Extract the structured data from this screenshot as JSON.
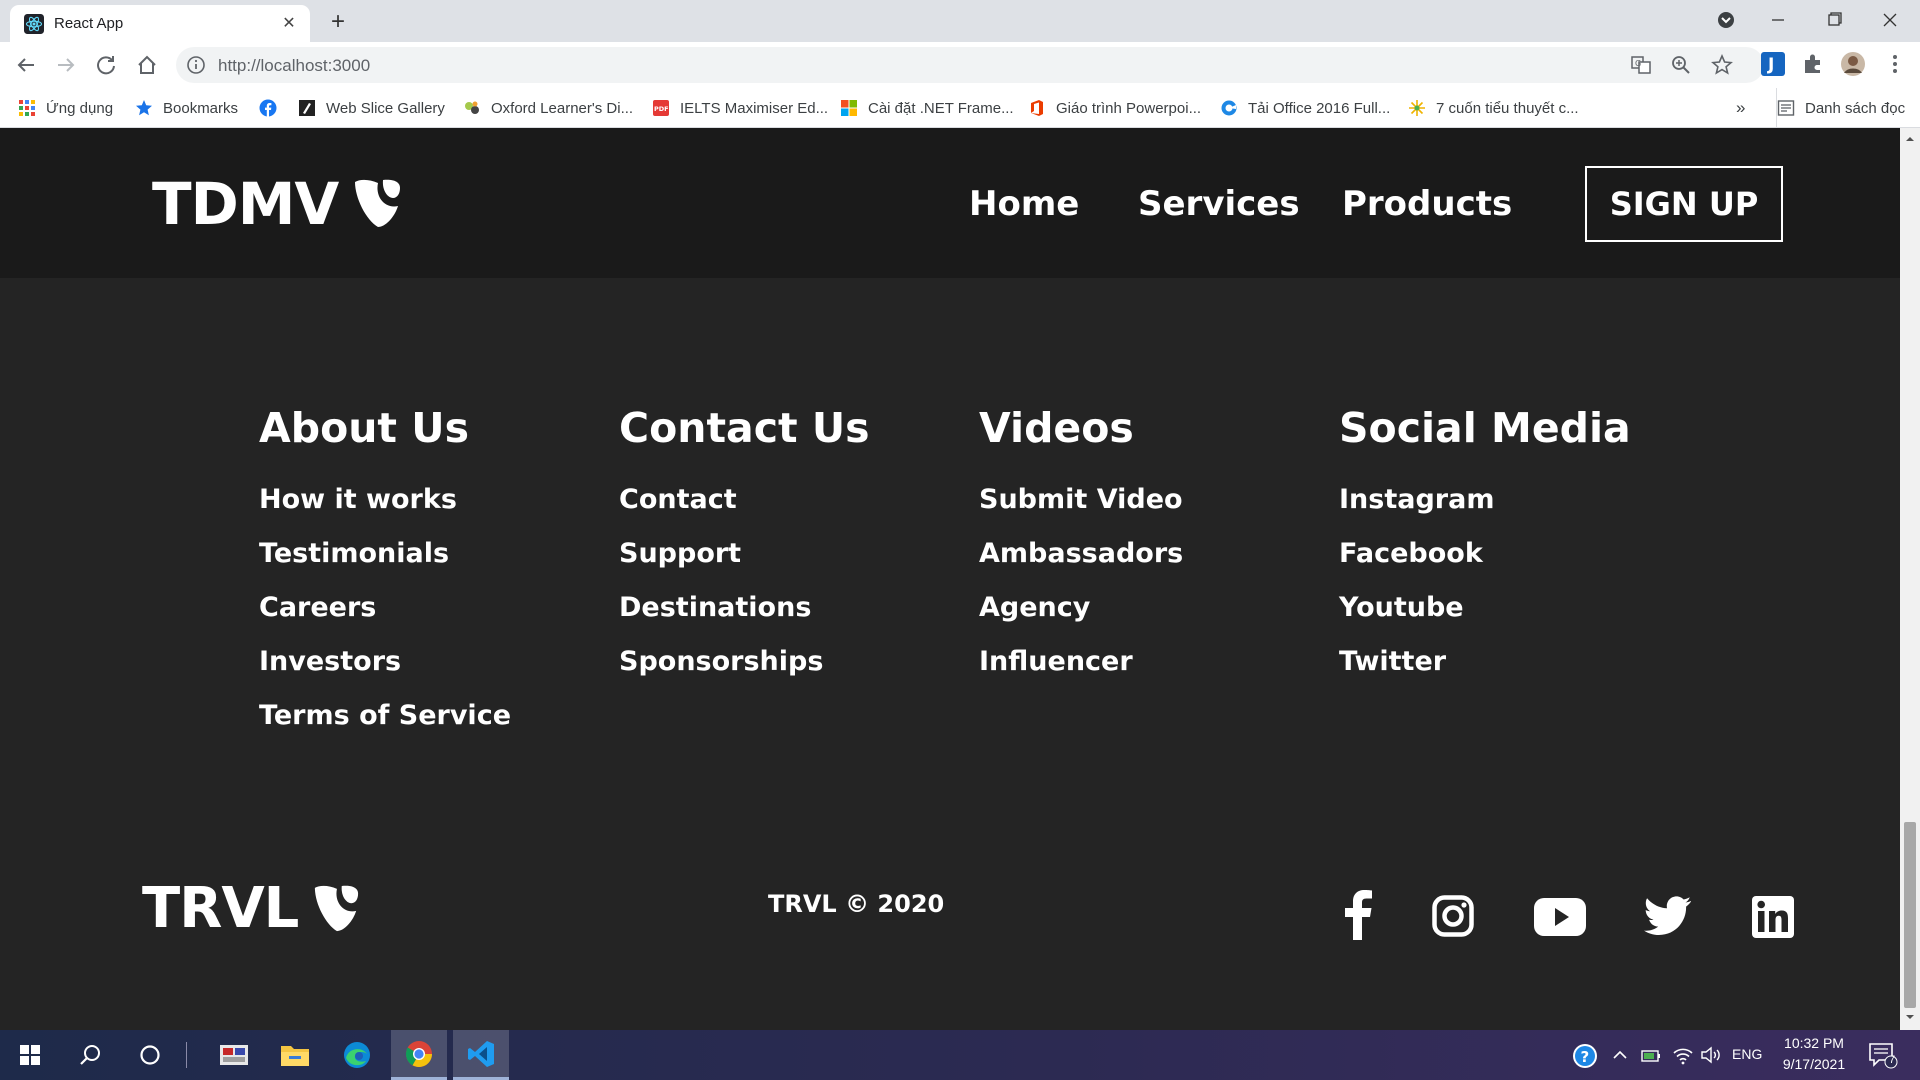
{
  "browser": {
    "tab_title": "React App",
    "url": "http://localhost:3000",
    "bookmarks": [
      {
        "label": "Ứng dụng",
        "icon": "apps-grid-icon"
      },
      {
        "label": "Bookmarks",
        "icon": "star-icon"
      },
      {
        "label": "",
        "icon": "facebook-icon"
      },
      {
        "label": "Web Slice Gallery",
        "icon": "web-slice-icon"
      },
      {
        "label": "Oxford Learner's Di...",
        "icon": "oxford-icon"
      },
      {
        "label": "IELTS Maximiser Ed...",
        "icon": "pdf-icon"
      },
      {
        "label": "Cài đặt .NET Frame...",
        "icon": "windows-logo-icon"
      },
      {
        "label": "Giáo trình Powerpoi...",
        "icon": "office-icon"
      },
      {
        "label": "Tải Office 2016 Full...",
        "icon": "blue-swirl-icon"
      },
      {
        "label": "7 cuốn tiểu thuyết c...",
        "icon": "sparkle-icon"
      }
    ],
    "bookmarks_overflow": "»",
    "reading_list": "Danh sách đọc"
  },
  "navbar": {
    "brand": "TDMV",
    "links": [
      "Home",
      "Services",
      "Products"
    ],
    "signup": "SIGN UP"
  },
  "footer": {
    "columns": [
      {
        "title": "About Us",
        "links": [
          "How it works",
          "Testimonials",
          "Careers",
          "Investors",
          "Terms of Service"
        ]
      },
      {
        "title": "Contact Us",
        "links": [
          "Contact",
          "Support",
          "Destinations",
          "Sponsorships"
        ]
      },
      {
        "title": "Videos",
        "links": [
          "Submit Video",
          "Ambassadors",
          "Agency",
          "Influencer"
        ]
      },
      {
        "title": "Social Media",
        "links": [
          "Instagram",
          "Facebook",
          "Youtube",
          "Twitter"
        ]
      }
    ],
    "brand": "TRVL",
    "copyright": "TRVL © 2020",
    "social_icons": [
      "facebook-icon",
      "instagram-icon",
      "youtube-icon",
      "twitter-icon",
      "linkedin-icon"
    ]
  },
  "taskbar": {
    "language": "ENG",
    "time": "10:32 PM",
    "date": "9/17/2021",
    "notification_count": "7"
  },
  "colors": {
    "page_bg": "#242424",
    "navbar_bg": "#1a1a1a",
    "text": "#ffffff"
  }
}
